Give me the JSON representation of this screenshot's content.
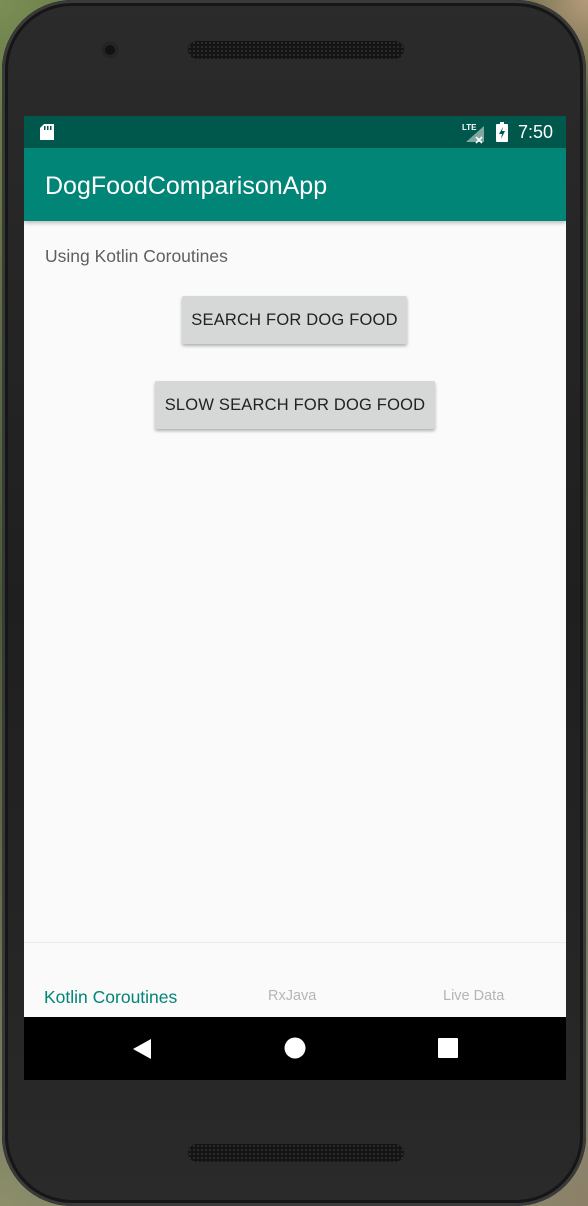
{
  "status_bar": {
    "time": "7:50",
    "network": "LTE",
    "icons": [
      "sd-card-icon",
      "lte-signal-icon",
      "battery-charging-icon"
    ]
  },
  "app_bar": {
    "title": "DogFoodComparisonApp"
  },
  "content": {
    "label": "Using Kotlin Coroutines",
    "search_button": "SEARCH FOR DOG FOOD",
    "slow_search_button": "SLOW SEARCH FOR DOG FOOD"
  },
  "bottom_nav": {
    "items": [
      {
        "label": "Kotlin Coroutines",
        "active": true
      },
      {
        "label": "RxJava",
        "active": false
      },
      {
        "label": "Live Data",
        "active": false
      }
    ]
  },
  "system_nav": {
    "icons": [
      "back-icon",
      "home-icon",
      "recents-icon"
    ]
  },
  "colors": {
    "primary": "#008577",
    "primary_dark": "#00574b",
    "button": "#d6d7d7",
    "background": "#fafafa"
  }
}
